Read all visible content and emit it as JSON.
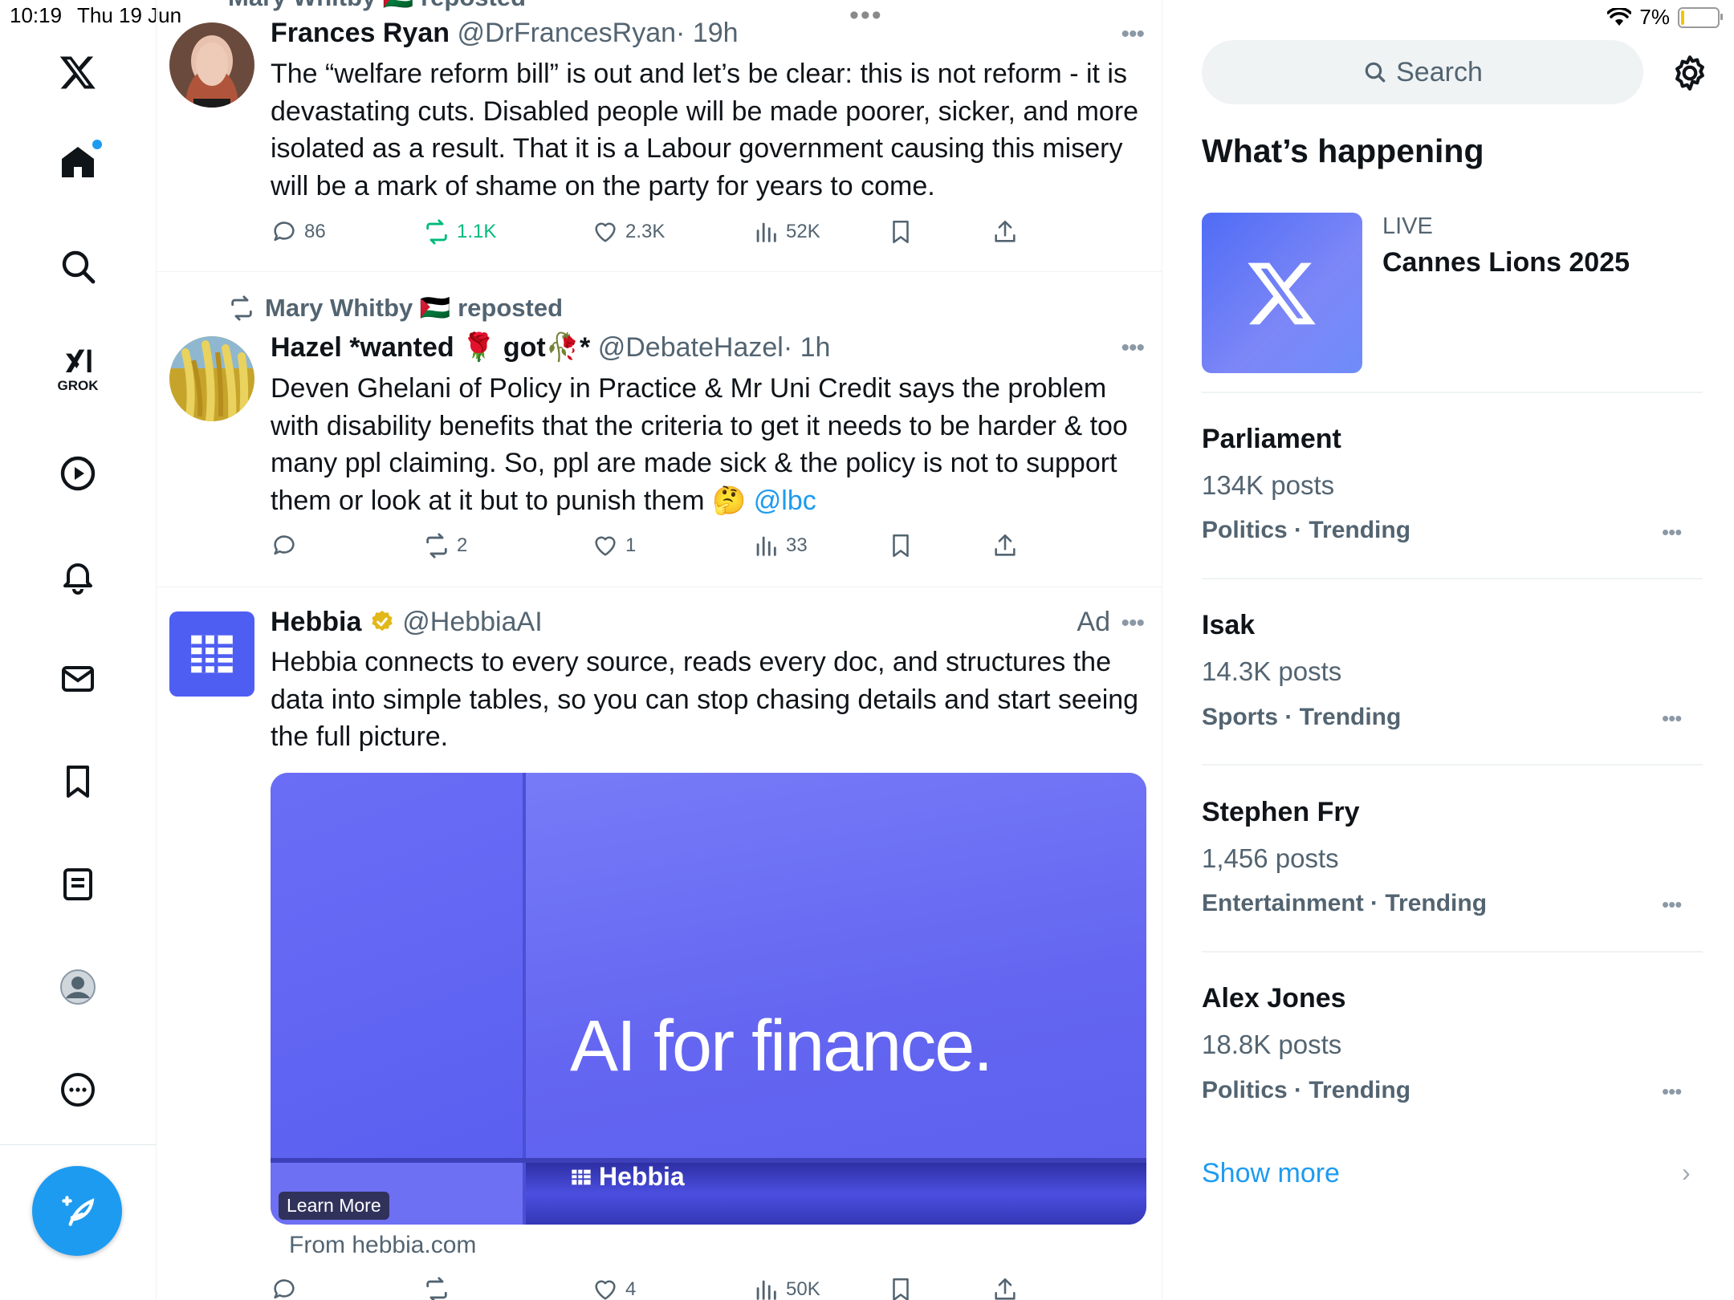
{
  "status_bar": {
    "time": "10:19",
    "date": "Thu 19 Jun",
    "battery": "7%",
    "center_dots": "•••"
  },
  "nav": {
    "grok_label": "GROK",
    "items": [
      "x-logo",
      "home",
      "explore",
      "grok",
      "video",
      "notifications",
      "messages",
      "bookmarks",
      "lists",
      "profile",
      "more"
    ]
  },
  "feed": {
    "posts": [
      {
        "repost_by": "Mary Whitby 🇵🇸 reposted",
        "name": "Frances Ryan",
        "handle": "@DrFrancesRyan",
        "time": "· 19h",
        "text": "The “welfare reform bill” is out and let’s be clear: this is not reform - it is devastating cuts. Disabled people will be made poorer, sicker, and more isolated as a result. That it is a Labour government causing this misery will be a mark of shame on the party for years to come.",
        "replies": "86",
        "reposts": "1.1K",
        "likes": "2.3K",
        "views": "52K"
      },
      {
        "repost_by": "Mary Whitby 🇵🇸 reposted",
        "name": "Hazel *wanted 🌹 got🥀*",
        "handle": "@DebateHazel",
        "time": "· 1h",
        "text": "Deven Ghelani of Policy in Practice & Mr Uni Credit says the problem with disability benefits that the criteria to get it needs to be harder & too many ppl claiming.  So, ppl are made sick & the policy is not to support them or look at it but to punish them 🤔",
        "mention": "@lbc",
        "replies": "",
        "reposts": "2",
        "likes": "1",
        "views": "33"
      },
      {
        "name": "Hebbia",
        "handle": "@HebbiaAI",
        "ad_label": "Ad",
        "text": "Hebbia connects to every source, reads every doc, and structures the data into simple tables, so you can stop chasing details and start seeing the full picture.",
        "media_text": "AI for finance.",
        "media_brand": "Hebbia",
        "learn_more": "Learn More",
        "from": "From hebbia.com",
        "replies": "",
        "reposts": "",
        "likes": "4",
        "views": "50K"
      }
    ]
  },
  "sidebar": {
    "search_placeholder": "Search",
    "section_title": "What’s happening",
    "live": {
      "label": "LIVE",
      "title": "Cannes Lions 2025"
    },
    "trends": [
      {
        "title": "Parliament",
        "count": "134K posts",
        "category": "Politics · Trending"
      },
      {
        "title": "Isak",
        "count": "14.3K posts",
        "category": "Sports · Trending"
      },
      {
        "title": "Stephen Fry",
        "count": "1,456 posts",
        "category": "Entertainment · Trending"
      },
      {
        "title": "Alex Jones",
        "count": "18.8K posts",
        "category": "Politics · Trending"
      }
    ],
    "show_more": "Show more"
  },
  "colors": {
    "accent": "#1d9bf0",
    "repost_green": "#00ba7c",
    "muted_text": "#536471",
    "ad_media_bg": "#5e63ef"
  }
}
